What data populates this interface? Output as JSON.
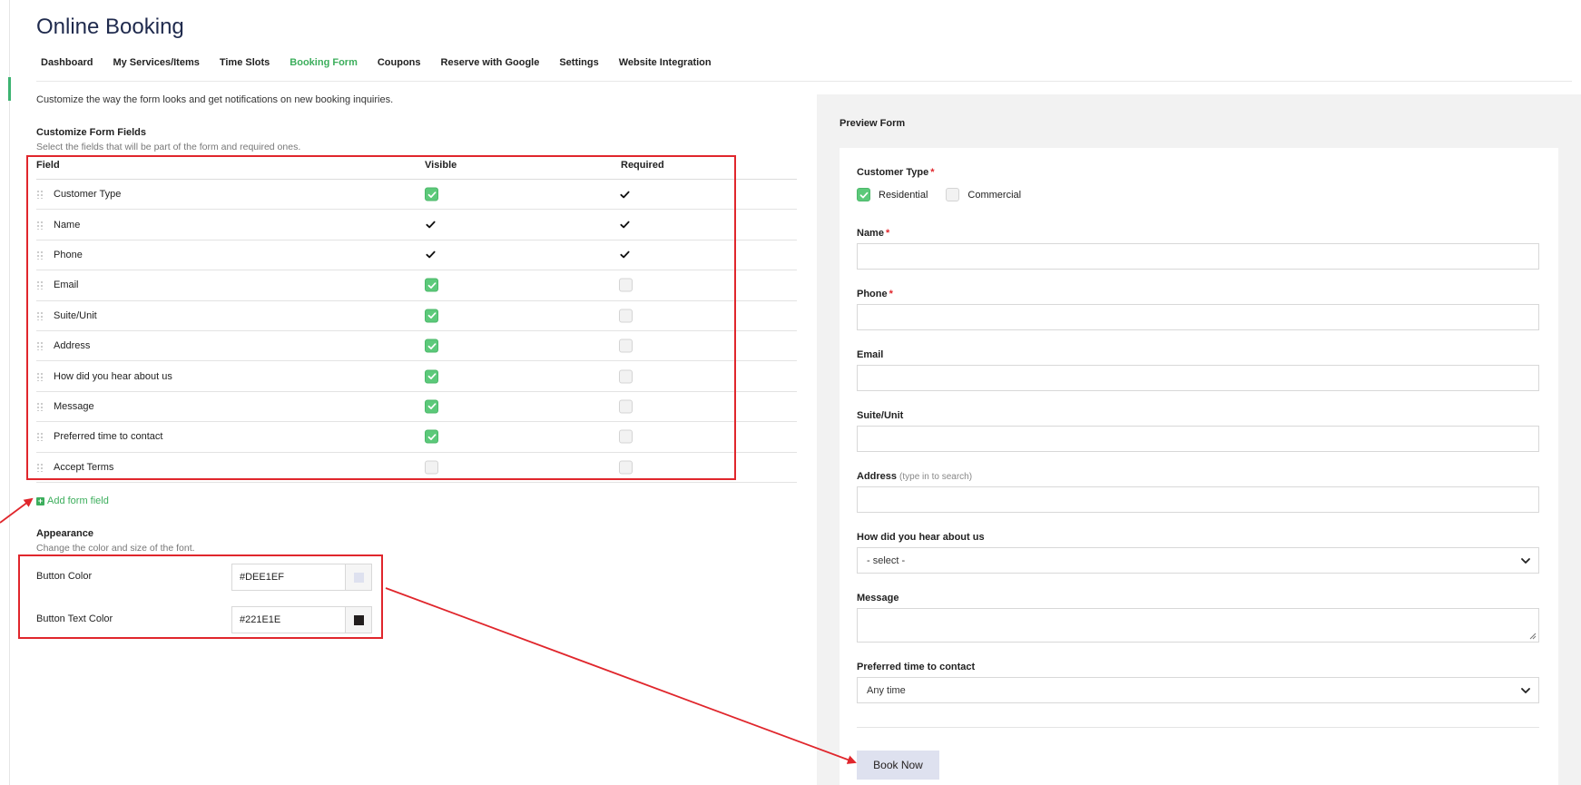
{
  "page": {
    "title": "Online Booking"
  },
  "tabs": [
    {
      "label": "Dashboard",
      "active": false
    },
    {
      "label": "My Services/Items",
      "active": false
    },
    {
      "label": "Time Slots",
      "active": false
    },
    {
      "label": "Booking Form",
      "active": true
    },
    {
      "label": "Coupons",
      "active": false
    },
    {
      "label": "Reserve with Google",
      "active": false
    },
    {
      "label": "Settings",
      "active": false
    },
    {
      "label": "Website Integration",
      "active": false
    }
  ],
  "intro": "Customize the way the form looks and get notifications on new booking inquiries.",
  "form_fields": {
    "title": "Customize Form Fields",
    "subtitle": "Select the fields that will be part of the form and required ones.",
    "columns": {
      "field": "Field",
      "visible": "Visible",
      "required": "Required"
    },
    "rows": [
      {
        "name": "Customer Type",
        "visible": "checked",
        "required": "locked"
      },
      {
        "name": "Name",
        "visible": "locked",
        "required": "locked"
      },
      {
        "name": "Phone",
        "visible": "locked",
        "required": "locked"
      },
      {
        "name": "Email",
        "visible": "checked",
        "required": "unchecked"
      },
      {
        "name": "Suite/Unit",
        "visible": "checked",
        "required": "unchecked"
      },
      {
        "name": "Address",
        "visible": "checked",
        "required": "unchecked"
      },
      {
        "name": "How did you hear about us",
        "visible": "checked",
        "required": "unchecked"
      },
      {
        "name": "Message",
        "visible": "checked",
        "required": "unchecked"
      },
      {
        "name": "Preferred time to contact",
        "visible": "checked",
        "required": "unchecked"
      },
      {
        "name": "Accept Terms",
        "visible": "unchecked",
        "required": "unchecked"
      }
    ],
    "add_label": "Add form field"
  },
  "appearance": {
    "title": "Appearance",
    "subtitle": "Change the color and size of the font.",
    "button_color": {
      "label": "Button Color",
      "value": "#DEE1EF"
    },
    "button_text_color": {
      "label": "Button Text Color",
      "value": "#221E1E"
    }
  },
  "preview": {
    "title": "Preview Form",
    "customer_type": {
      "label": "Customer Type",
      "required_mark": "*",
      "options": [
        "Residential",
        "Commercial"
      ],
      "selected": "Residential"
    },
    "name": {
      "label": "Name",
      "required_mark": "*",
      "value": ""
    },
    "phone": {
      "label": "Phone",
      "required_mark": "*",
      "value": ""
    },
    "email": {
      "label": "Email",
      "value": ""
    },
    "suite": {
      "label": "Suite/Unit",
      "value": ""
    },
    "address": {
      "label": "Address",
      "hint": "(type in to search)",
      "value": ""
    },
    "hear_about": {
      "label": "How did you hear about us",
      "selected": "- select -"
    },
    "message": {
      "label": "Message",
      "value": ""
    },
    "preferred_time": {
      "label": "Preferred time to contact",
      "selected": "Any time"
    },
    "submit_label": "Book Now"
  },
  "colors": {
    "accent": "#3cae5c",
    "checkbox_on": "#5cc97a",
    "annotation_red": "#e0262c",
    "preview_bg": "#f2f2f2"
  }
}
